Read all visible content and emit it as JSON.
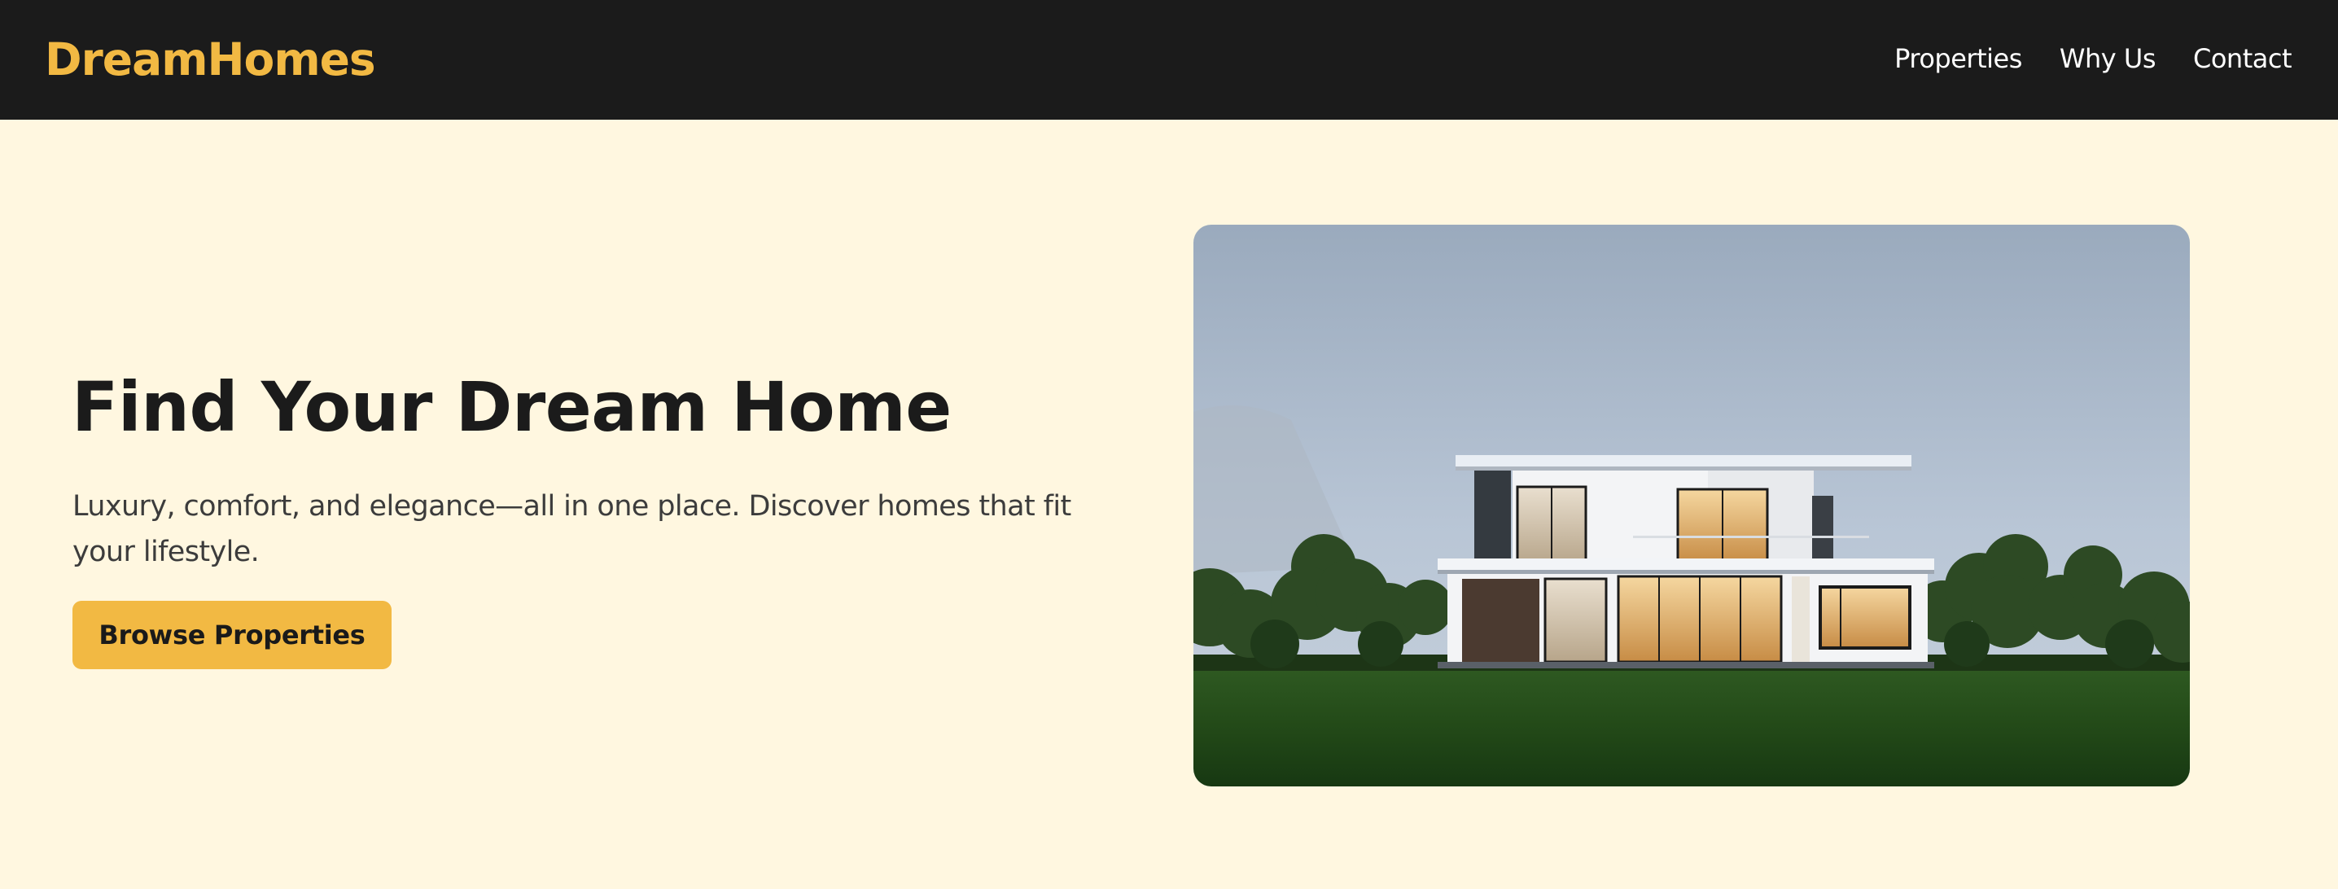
{
  "header": {
    "brand": "DreamHomes",
    "nav": [
      {
        "label": "Properties"
      },
      {
        "label": "Why Us"
      },
      {
        "label": "Contact"
      }
    ]
  },
  "hero": {
    "title": "Find Your Dream Home",
    "text": "Luxury, comfort, and elegance—all in one place. Discover homes that fit your lifestyle.",
    "cta_label": "Browse Properties",
    "image": {
      "subject": "modern two-storey house on a lawn at dusk"
    }
  },
  "colors": {
    "header_bg": "#1b1b1b",
    "page_bg": "#fff7e0",
    "accent": "#f2b943",
    "nav_text": "#ffffff",
    "heading": "#1b1b1b",
    "body_text": "#3c3c3c"
  }
}
